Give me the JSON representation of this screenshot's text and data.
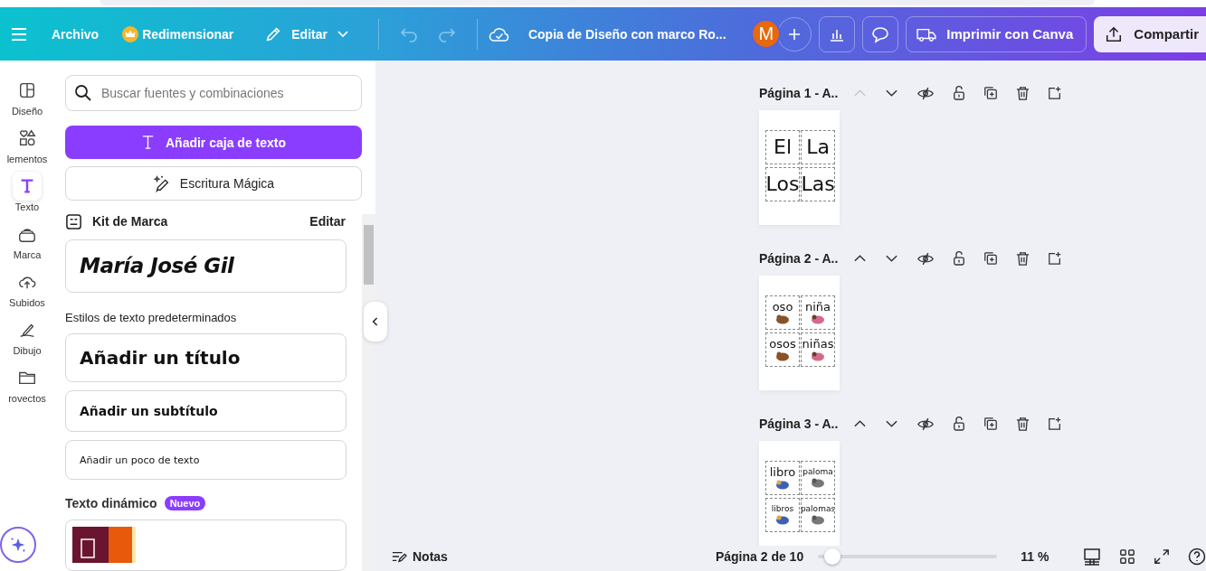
{
  "header": {
    "file_menu": "Archivo",
    "resize": "Redimensionar",
    "edit": "Editar",
    "title": "Copia de Diseño con marco Ro...",
    "avatar": "M",
    "print": "Imprimir con Canva",
    "share": "Compartir"
  },
  "rail": [
    {
      "label": "Diseño",
      "kind": "design",
      "selected": false
    },
    {
      "label": "lementos",
      "kind": "elements",
      "selected": false
    },
    {
      "label": "Texto",
      "kind": "text",
      "selected": true
    },
    {
      "label": "Marca",
      "kind": "brand",
      "selected": false
    },
    {
      "label": "Subidos",
      "kind": "uploads",
      "selected": false
    },
    {
      "label": "Dibujo",
      "kind": "draw",
      "selected": false
    },
    {
      "label": "rovectos",
      "kind": "projects",
      "selected": false
    }
  ],
  "panel": {
    "search": {
      "placeholder": "Buscar fuentes y combinaciones"
    },
    "add_text": "Añadir caja de texto",
    "magic": "Escritura Mágica",
    "brand_kit": {
      "title": "Kit de Marca",
      "edit": "Editar",
      "sample": "María José Gil"
    },
    "defaults_heading": "Estilos de texto predeterminados",
    "styles": [
      {
        "kind": "title",
        "label": "Añadir un título"
      },
      {
        "kind": "subtitle",
        "label": "Añadir un subtítulo"
      },
      {
        "kind": "body",
        "label": "Añadir un poco de texto"
      }
    ],
    "dynamic": {
      "heading": "Texto dinámico",
      "badge": "Nuevo"
    }
  },
  "pages": [
    {
      "title": "Página 1 - A..",
      "up_disabled": true,
      "cells": [
        {
          "word": "El",
          "picture": false
        },
        {
          "word": "La",
          "picture": false
        },
        {
          "word": "Los",
          "picture": false
        },
        {
          "word": "Las",
          "picture": false
        }
      ]
    },
    {
      "title": "Página 2 - A..",
      "up_disabled": false,
      "cells": [
        {
          "word": "oso",
          "picture": true
        },
        {
          "word": "niña",
          "picture": true
        },
        {
          "word": "osos",
          "picture": true
        },
        {
          "word": "niñas",
          "picture": true
        }
      ]
    },
    {
      "title": "Página 3 - A..",
      "up_disabled": false,
      "cells": [
        {
          "word": "libro",
          "picture": true
        },
        {
          "word": "paloma",
          "picture": true
        },
        {
          "word": "libros",
          "picture": true
        },
        {
          "word": "palomas",
          "picture": true
        }
      ]
    }
  ],
  "footer": {
    "notes": "Notas",
    "page_indicator": "Página 2 de 10",
    "zoom": {
      "level": 0.08,
      "reading": "11 %"
    }
  }
}
